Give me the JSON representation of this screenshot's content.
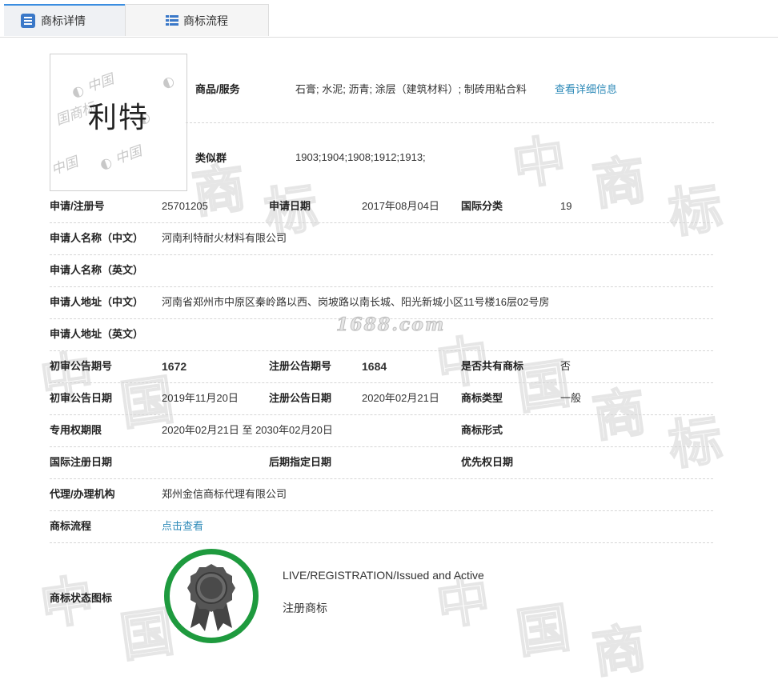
{
  "tabs": [
    {
      "label": "商标详情",
      "icon": "list-icon"
    },
    {
      "label": "商标流程",
      "icon": "grid-icon"
    }
  ],
  "logo": {
    "name": "利特",
    "watermark_text": "中国商标"
  },
  "watermark_site": "1688.com",
  "goods_services": {
    "label": "商品/服务",
    "value": "石膏; 水泥; 沥青; 涂层（建筑材料）; 制砖用粘合料",
    "link": "查看详细信息"
  },
  "similar_group": {
    "label": "类似群",
    "value": "1903;1904;1908;1912;1913;"
  },
  "rows": {
    "reg_no_label": "申请/注册号",
    "reg_no": "25701205",
    "app_date_label": "申请日期",
    "app_date": "2017年08月04日",
    "intl_class_label": "国际分类",
    "intl_class": "19",
    "applicant_cn_label": "申请人名称（中文）",
    "applicant_cn": "河南利特耐火材料有限公司",
    "applicant_en_label": "申请人名称（英文）",
    "address_cn_label": "申请人地址（中文）",
    "address_cn": "河南省郑州市中原区秦岭路以西、岗坡路以南长城、阳光新城小区11号楼16层02号房",
    "address_en_label": "申请人地址（英文）",
    "prelim_no_label": "初审公告期号",
    "prelim_no": "1672",
    "reg_pub_no_label": "注册公告期号",
    "reg_pub_no": "1684",
    "shared_label": "是否共有商标",
    "shared": "否",
    "prelim_date_label": "初审公告日期",
    "prelim_date": "2019年11月20日",
    "reg_pub_date_label": "注册公告日期",
    "reg_pub_date": "2020年02月21日",
    "type_label": "商标类型",
    "type": "一般",
    "term_label": "专用权期限",
    "term": "2020年02月21日 至 2030年02月20日",
    "form_label": "商标形式",
    "intl_reg_date_label": "国际注册日期",
    "later_designation_label": "后期指定日期",
    "priority_date_label": "优先权日期",
    "agent_label": "代理/办理机构",
    "agent": "郑州金信商标代理有限公司",
    "flow_label": "商标流程",
    "flow_link": "点击查看"
  },
  "status": {
    "label": "商标状态图标",
    "en": "LIVE/REGISTRATION/Issued and Active",
    "cn": "注册商标",
    "icon": "award-ribbon-icon",
    "ring_color": "#1e9a3e"
  }
}
